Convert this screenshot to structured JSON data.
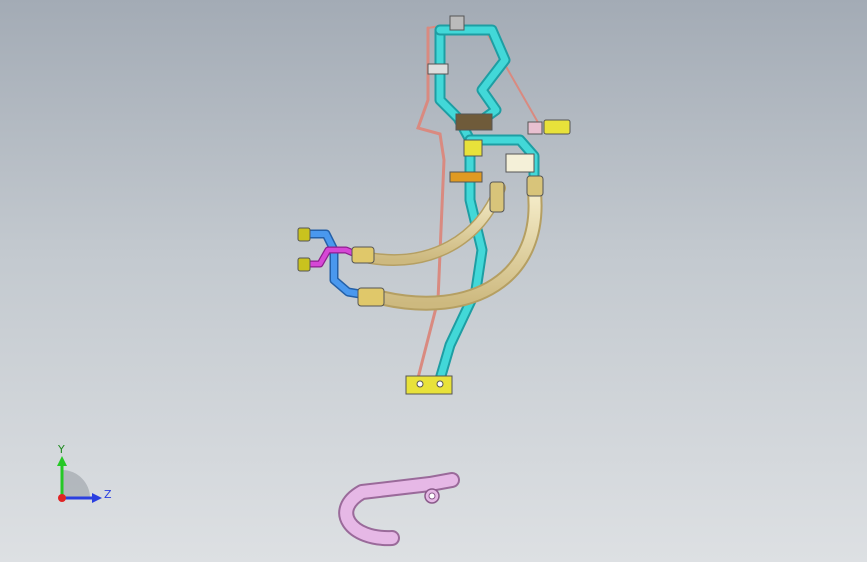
{
  "viewport": {
    "background_top": "#a3abb5",
    "background_bottom": "#dde0e3"
  },
  "model": {
    "colors": {
      "cyan_pipe": "#3ed4d4",
      "cyan_dark": "#1e9ea3",
      "beige_hose": "#eadca8",
      "beige_dark": "#b59f62",
      "blue_pipe": "#3e8de8",
      "magenta_pipe": "#d23fd2",
      "salmon_rod": "#e0948a",
      "yellow_fitting": "#e8e23a",
      "pink_part": "#e3b6e3"
    }
  },
  "triad": {
    "y_label": "Y",
    "z_label": "Z",
    "y_color": "#26c826",
    "z_color": "#2a3fe0",
    "x_color": "#e02424"
  }
}
